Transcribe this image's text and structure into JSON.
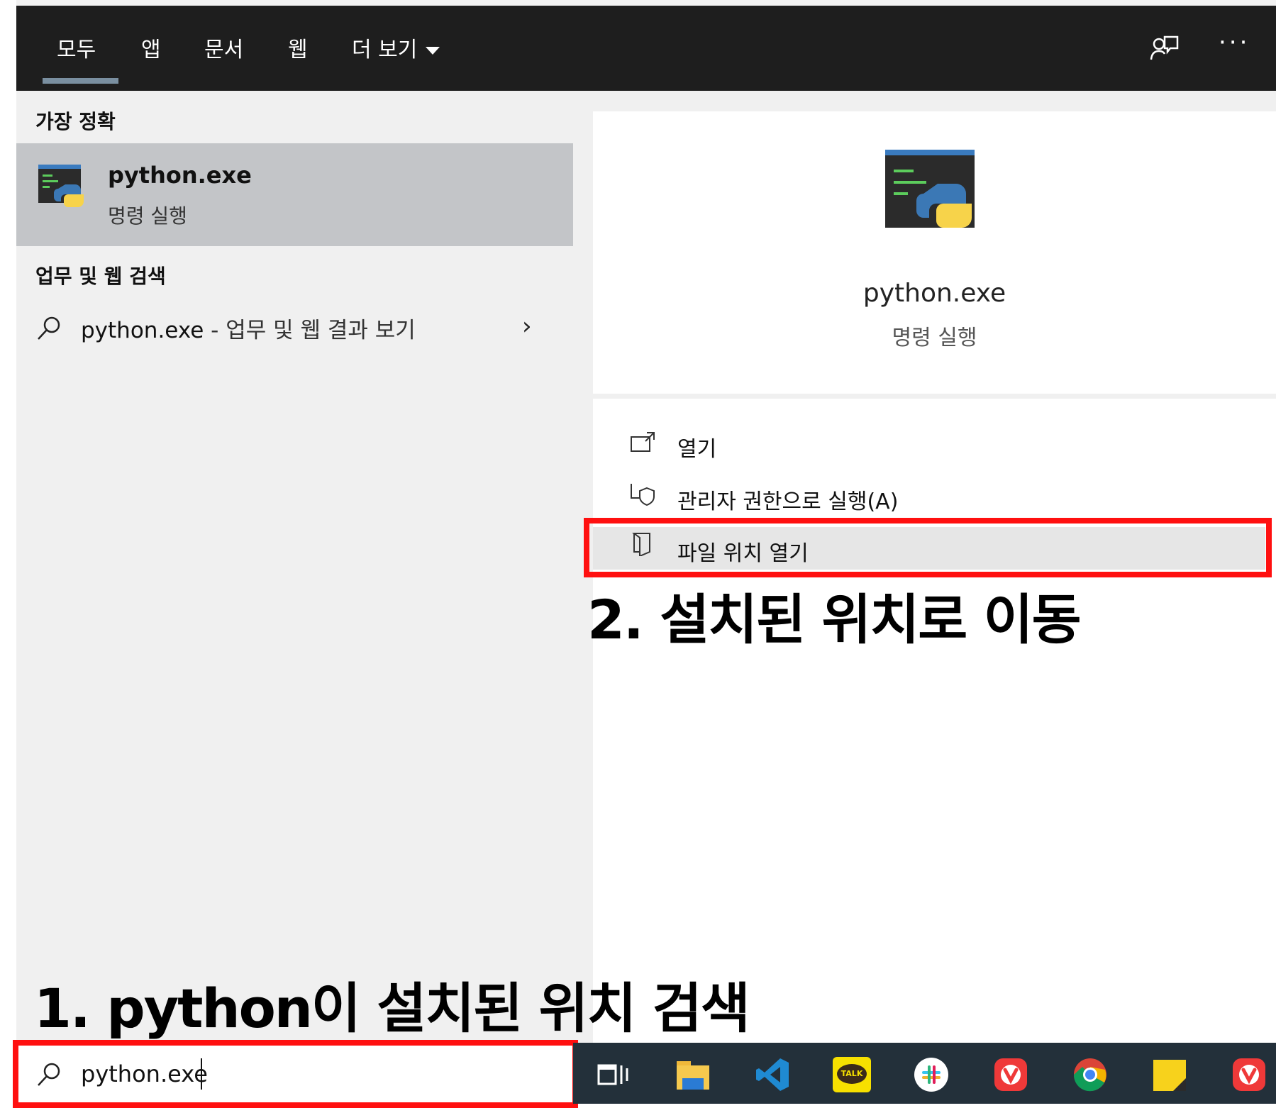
{
  "tabs": [
    "모두",
    "앱",
    "문서",
    "웹",
    "더 보기"
  ],
  "top_icons": {
    "feedback": "feedback-icon",
    "more": "···"
  },
  "left": {
    "best_match_title": "가장 정확",
    "best_match": {
      "name": "python.exe",
      "type": "명령 실행"
    },
    "web_section_title": "업무 및 웹 검색",
    "web_item": {
      "query": "python.exe",
      "suffix": " - 업무 및 웹 결과 보기"
    }
  },
  "right": {
    "app_name": "python.exe",
    "app_type": "명령 실행",
    "actions": [
      "열기",
      "관리자 권한으로 실행(A)",
      "파일 위치 열기"
    ]
  },
  "annotations": {
    "step2": "2. 설치된 위치로 이동",
    "step1": "1. python이 설치된 위치 검색"
  },
  "search": {
    "value": "python.exe"
  },
  "taskbar_icons": [
    "task-view-icon",
    "file-explorer-icon",
    "vscode-icon",
    "kakaotalk-icon",
    "slack-icon",
    "vivaldi-icon",
    "chrome-icon",
    "sticky-notes-icon",
    "vivaldi-icon"
  ],
  "kakao_label": "TALK",
  "colors": {
    "highlight_red": "#ff1010",
    "taskbar": "#23303a",
    "topbar": "#1e1e1e"
  }
}
